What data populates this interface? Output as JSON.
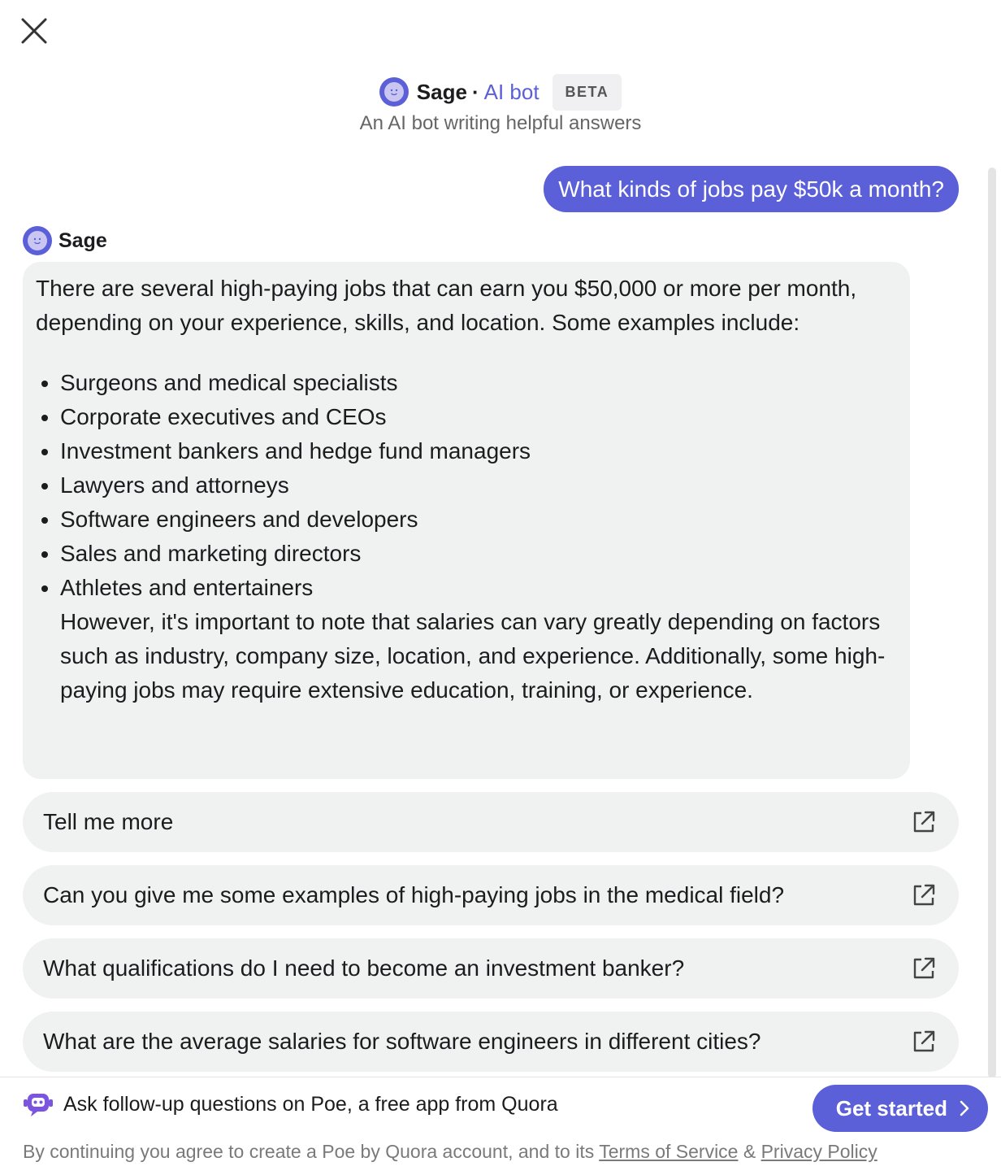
{
  "header": {
    "bot_name": "Sage",
    "separator": "·",
    "bot_kind": "AI bot",
    "badge": "BETA",
    "subtitle": "An AI bot writing helpful answers"
  },
  "conversation": {
    "user_message": "What kinds of jobs pay $50k a month?",
    "bot_label": "Sage",
    "answer": {
      "intro": "There are several high-paying jobs that can earn you $50,000 or more per month, depending on your experience, skills, and location. Some examples include:",
      "items": [
        "Surgeons and medical specialists",
        "Corporate executives and CEOs",
        "Investment bankers and hedge fund managers",
        "Lawyers and attorneys",
        "Software engineers and developers",
        "Sales and marketing directors",
        "Athletes and entertainers"
      ],
      "outro": "However, it's important to note that salaries can vary greatly depending on factors such as industry, company size, location, and experience. Additionally, some high-paying jobs may require extensive education, training, or experience."
    }
  },
  "suggestions": [
    "Tell me more",
    "Can you give me some examples of high-paying jobs in the medical field?",
    "What qualifications do I need to become an investment banker?",
    "What are the average salaries for software engineers in different cities?"
  ],
  "footer": {
    "message": "Ask follow-up questions on Poe, a free app from Quora",
    "cta_label": "Get started",
    "legal_prefix": "By continuing you agree to create a Poe by Quora account, and to its ",
    "terms_label": "Terms of Service",
    "legal_amp": " & ",
    "privacy_label": "Privacy Policy"
  },
  "icons": {
    "close": "close-icon",
    "avatar": "sage-avatar-icon",
    "external": "external-link-icon",
    "poe": "poe-logo-icon",
    "chevron": "chevron-right-icon"
  },
  "colors": {
    "accent": "#5b5fd8",
    "bubble_bg": "#f0f1f1",
    "muted_text": "#7a7a7a"
  }
}
